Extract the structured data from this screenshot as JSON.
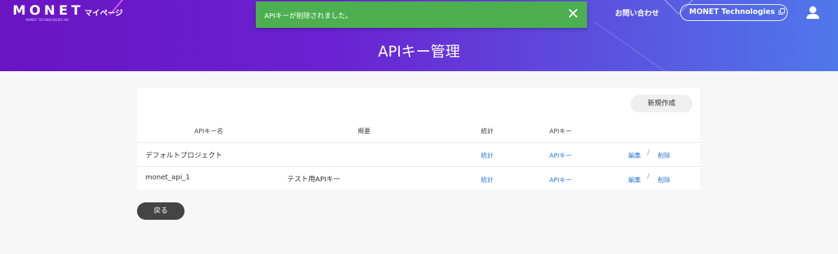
{
  "header": {
    "logo": {
      "main": "MONET",
      "sub": "MONET TECHNOLOGIES INC."
    },
    "mypage_label": "マイページ",
    "contact_label": "お問い合わせ",
    "company_link_label": "MONET Technologies",
    "page_title": "APIキー管理"
  },
  "toast": {
    "message": "APIキーが削除されました。",
    "color": "#4caf50"
  },
  "actions": {
    "new_label": "新規作成",
    "back_label": "戻る"
  },
  "table": {
    "columns": [
      "APIキー名",
      "概要",
      "統計",
      "APIキー"
    ],
    "rows": [
      {
        "name": "デフォルトプロジェクト",
        "summary": "",
        "stats": "統計",
        "apikey": "APIキー",
        "edit": "編集",
        "delete": "削除"
      },
      {
        "name": "monet_api_1",
        "summary": "テスト用APIキー",
        "stats": "統計",
        "apikey": "APIキー",
        "edit": "編集",
        "delete": "削除"
      }
    ],
    "separator": "/"
  },
  "colors": {
    "header_gradient_start": "#6a14c4",
    "header_gradient_end": "#4f78ea",
    "link": "#2a7bd6",
    "back_button": "#444444"
  },
  "icons": [
    "close-icon",
    "external-link-icon",
    "user-icon"
  ]
}
